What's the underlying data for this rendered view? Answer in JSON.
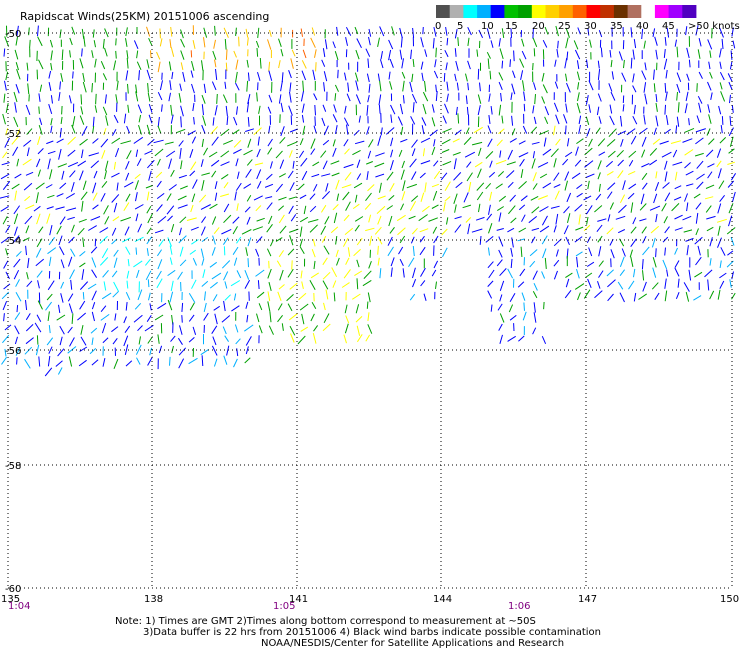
{
  "title": "Rapidscat Winds(25KM) 20151006 ascending",
  "legend": {
    "labels": [
      "0",
      "5",
      "10",
      "15",
      "20",
      "25",
      "30",
      "35",
      "40",
      "45",
      ">50 knots"
    ],
    "colors": [
      "#505050",
      "#b0b0b0",
      "#00ffff",
      "#00b0ff",
      "#0000ff",
      "#00c000",
      "#00a000",
      "#ffff00",
      "#ffd000",
      "#ffa000",
      "#ff6000",
      "#ff0000",
      "#c03000",
      "#6a3000",
      "#b07060",
      "#ffffff",
      "#ff00ff",
      "#a000ff",
      "#5000c0"
    ]
  },
  "axes": {
    "lon_labels": [
      "135",
      "138",
      "141",
      "144",
      "147",
      "150"
    ],
    "lat_labels": [
      "-50",
      "-52",
      "-54",
      "-56",
      "-58",
      "-60"
    ],
    "time_labels": [
      "1:04",
      "1:05",
      "1:06"
    ]
  },
  "notes": {
    "line1": "Note: 1) Times are GMT 2)Times along bottom correspond to measurement at ~50S",
    "line2": "3)Data buffer is 22 hrs from 20151006 4) Black wind barbs indicate possible contamination",
    "line3": "NOAA/NESDIS/Center for Satellite Applications and Research"
  },
  "colors": {
    "grid": "#000000",
    "background": "#ffffff",
    "time_label": "#800080"
  }
}
